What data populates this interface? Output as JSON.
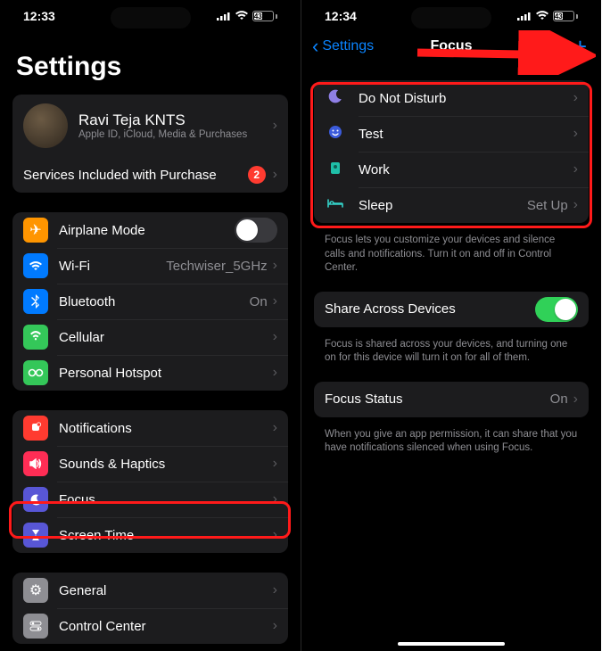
{
  "left": {
    "time": "12:33",
    "battery": "43",
    "title": "Settings",
    "profile": {
      "name": "Ravi Teja KNTS",
      "sub": "Apple ID, iCloud, Media & Purchases"
    },
    "services": {
      "label": "Services Included with Purchase",
      "badge": "2"
    },
    "g1": {
      "airplane": "Airplane Mode",
      "wifi": "Wi-Fi",
      "wifi_val": "Techwiser_5GHz",
      "bt": "Bluetooth",
      "bt_val": "On",
      "cell": "Cellular",
      "hotspot": "Personal Hotspot"
    },
    "g2": {
      "notif": "Notifications",
      "sounds": "Sounds & Haptics",
      "focus": "Focus",
      "screentime": "Screen Time"
    },
    "g3": {
      "general": "General",
      "cc": "Control Center"
    }
  },
  "right": {
    "time": "12:34",
    "battery": "43",
    "back": "Settings",
    "title": "Focus",
    "list": {
      "dnd": "Do Not Disturb",
      "test": "Test",
      "work": "Work",
      "sleep": "Sleep",
      "sleep_val": "Set Up"
    },
    "footer1": "Focus lets you customize your devices and silence calls and notifications. Turn it on and off in Control Center.",
    "share": "Share Across Devices",
    "footer2": "Focus is shared across your devices, and turning one on for this device will turn it on for all of them.",
    "status": "Focus Status",
    "status_val": "On",
    "footer3": "When you give an app permission, it can share that you have notifications silenced when using Focus."
  }
}
